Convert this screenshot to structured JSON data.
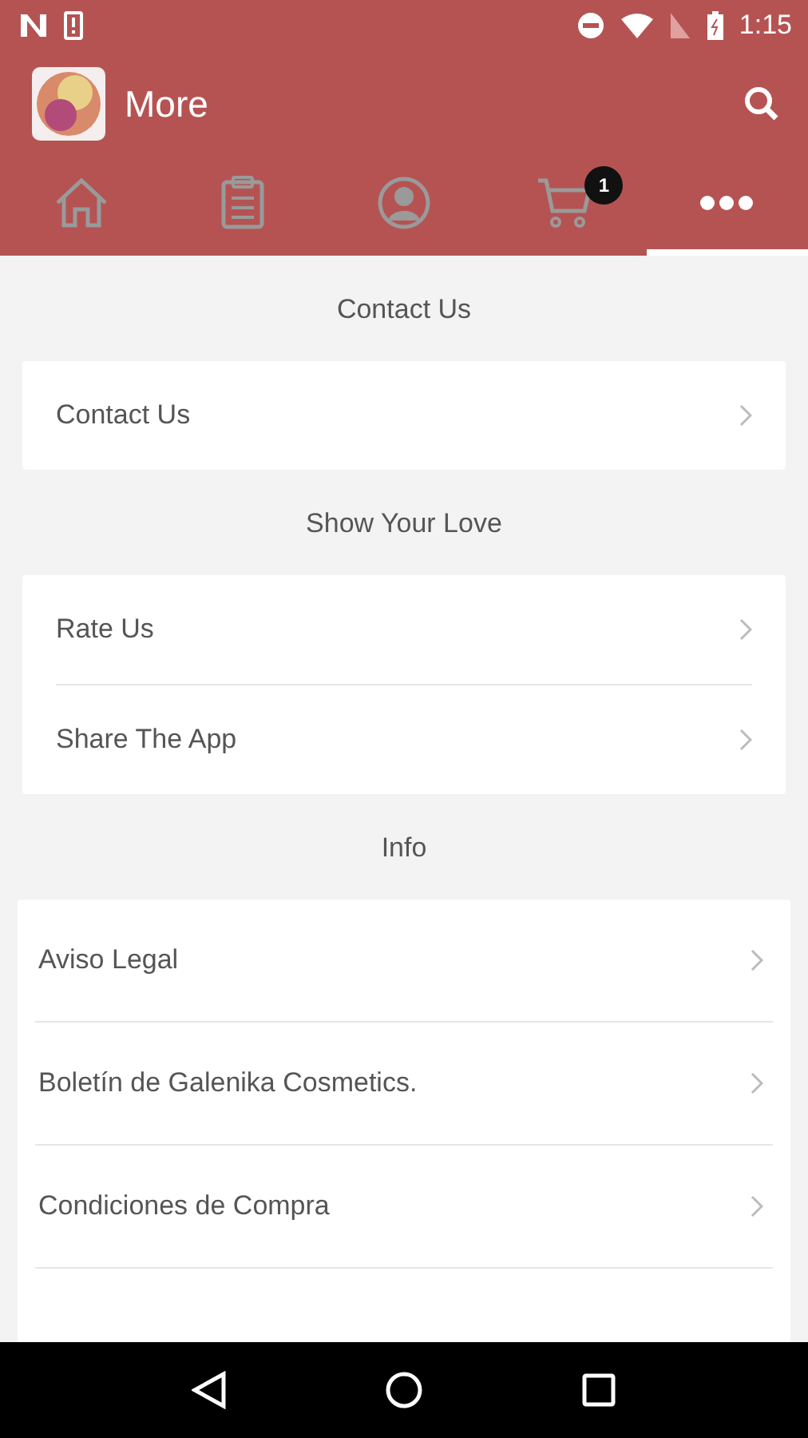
{
  "status_bar": {
    "time": "1:15"
  },
  "app_bar": {
    "title": "More"
  },
  "tabs": [
    {
      "kind": "home",
      "selected": false
    },
    {
      "kind": "list",
      "selected": false
    },
    {
      "kind": "profile",
      "selected": false
    },
    {
      "kind": "cart",
      "selected": false,
      "badge": "1"
    },
    {
      "kind": "more",
      "selected": true
    }
  ],
  "sections": [
    {
      "header": "Contact Us",
      "items": [
        "Contact Us"
      ]
    },
    {
      "header": "Show Your Love",
      "items": [
        "Rate Us",
        "Share The App"
      ]
    },
    {
      "header": "Info",
      "wide": true,
      "items": [
        "Aviso Legal",
        "Boletín de Galenika Cosmetics.",
        "Condiciones de Compra"
      ],
      "cut_row": true
    }
  ]
}
